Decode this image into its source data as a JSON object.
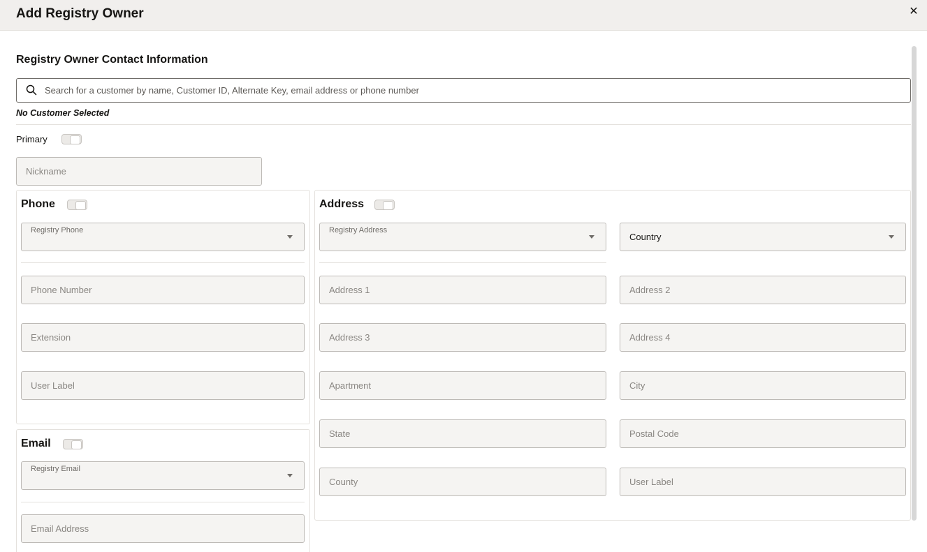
{
  "dialog": {
    "title": "Add Registry Owner",
    "close_icon": "close-icon"
  },
  "section": {
    "title": "Registry Owner Contact Information",
    "search_placeholder": "Search for a customer by name, Customer ID, Alternate Key, email address or phone number",
    "search_icon": "search-icon",
    "no_customer": "No Customer Selected",
    "primary_label": "Primary",
    "nickname_placeholder": "Nickname"
  },
  "phone": {
    "title": "Phone",
    "registry_label": "Registry Phone",
    "number_placeholder": "Phone Number",
    "extension_placeholder": "Extension",
    "user_label_placeholder": "User Label"
  },
  "email": {
    "title": "Email",
    "registry_label": "Registry Email",
    "address_placeholder": "Email Address"
  },
  "address": {
    "title": "Address",
    "registry_label": "Registry Address",
    "country_label": "Country",
    "address1": "Address 1",
    "address2": "Address 2",
    "address3": "Address 3",
    "address4": "Address 4",
    "apartment": "Apartment",
    "city": "City",
    "state": "State",
    "postal_code": "Postal Code",
    "county": "County",
    "user_label": "User Label"
  }
}
